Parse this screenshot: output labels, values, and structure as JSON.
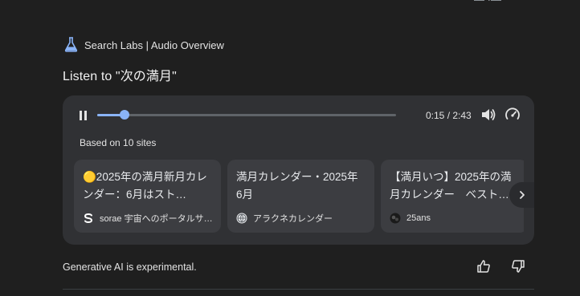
{
  "header": {
    "labs_label": "Search Labs | Audio Overview",
    "listen_title": "Listen to \"次の満月\""
  },
  "player": {
    "current_time": "0:15",
    "duration": "2:43",
    "progress_fraction": 0.092,
    "accent_color": "#8ab4f8"
  },
  "sources": {
    "based_on": "Based on 10 sites",
    "items": [
      {
        "title": "🟡2025年の満月新月カレンダー：6月はスト…",
        "site": "sorae 宇宙へのポータルサ…",
        "favicon": "s-logo-icon"
      },
      {
        "title": "満月カレンダー・2025年6月",
        "site": "アラクネカレンダー",
        "favicon": "globe-icon"
      },
      {
        "title": "【満月いつ】2025年の満月カレンダー　ベスト…",
        "site": "25ans",
        "favicon": "dark-logo-icon"
      }
    ]
  },
  "footer": {
    "disclaimer": "Generative AI is experimental."
  }
}
